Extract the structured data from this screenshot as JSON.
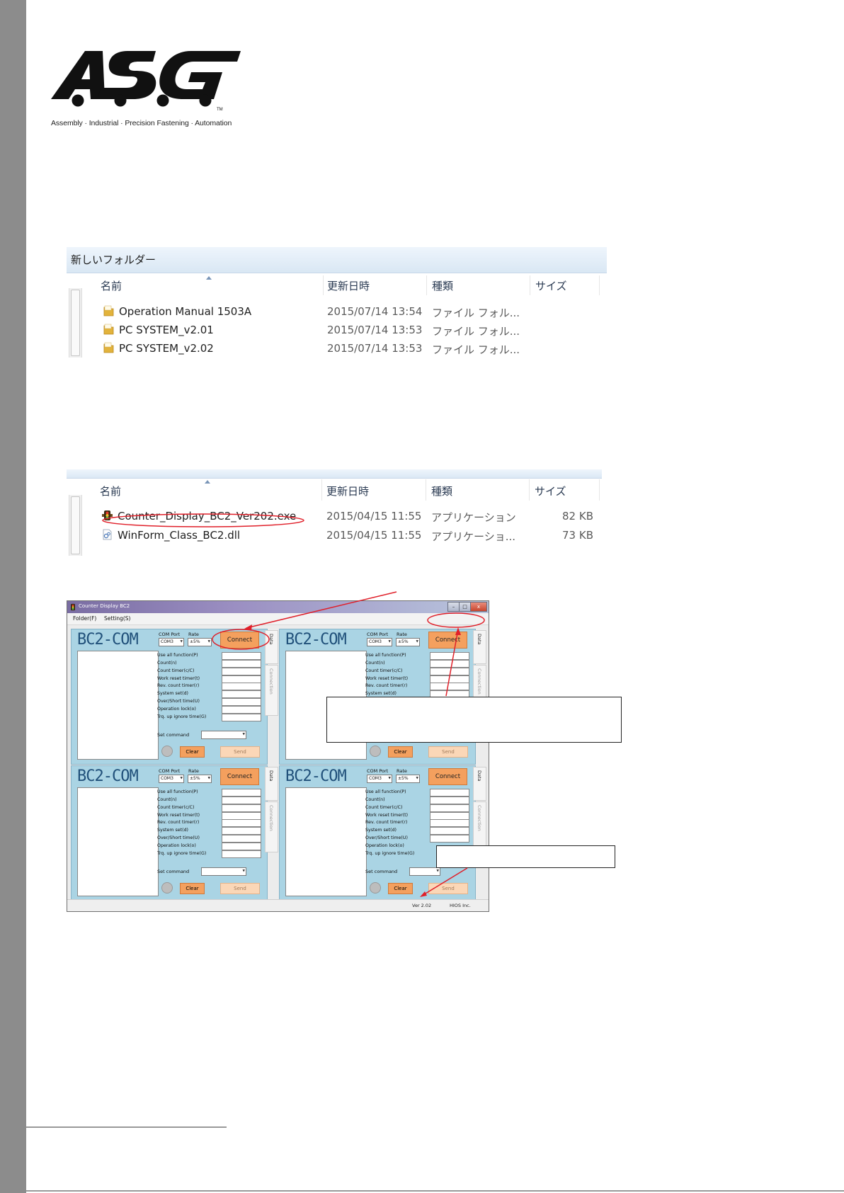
{
  "logo": {
    "text": "ASG",
    "trademark": "TM",
    "tagline": "Assembly · Industrial · Precision Fastening · Automation"
  },
  "explorer1": {
    "folder_title": "新しいフォルダー",
    "columns": [
      "名前",
      "更新日時",
      "種類",
      "サイズ"
    ],
    "rows": [
      {
        "name": "Operation Manual 1503A",
        "date": "2015/07/14 13:54",
        "type": "ファイル フォル...",
        "size": ""
      },
      {
        "name": "PC SYSTEM_v2.01",
        "date": "2015/07/14 13:53",
        "type": "ファイル フォル...",
        "size": ""
      },
      {
        "name": "PC SYSTEM_v2.02",
        "date": "2015/07/14 13:53",
        "type": "ファイル フォル...",
        "size": ""
      }
    ]
  },
  "explorer2": {
    "columns": [
      "名前",
      "更新日時",
      "種類",
      "サイズ"
    ],
    "rows": [
      {
        "name": "Counter_Display_BC2_Ver202.exe",
        "date": "2015/04/15 11:55",
        "type": "アプリケーション",
        "size": "82 KB",
        "icon": "traffic-light-icon"
      },
      {
        "name": "WinForm_Class_BC2.dll",
        "date": "2015/04/15 11:55",
        "type": "アプリケーショ...",
        "size": "73 KB",
        "icon": "dll-file-icon"
      }
    ]
  },
  "app": {
    "window_title": "Counter Display BC2",
    "window_buttons": {
      "minimize": "–",
      "maximize": "□",
      "close": "x"
    },
    "menu": [
      "Folder(F)",
      "Setting(S)"
    ],
    "panel_title": "BC2-COM",
    "com_port_label": "COM Port",
    "rate_label": "Rate",
    "com_port_value": "COM3",
    "rate_value": "±5%",
    "connect_label": "Connect",
    "functions": [
      "Use all function(P)",
      "Count(n)",
      "Count timer(c/C)",
      "Work reset timer(t)",
      "Rev. count timer(r)",
      "System set(d)",
      "Over/Short time(U)",
      "Operation lock(o)",
      "Trq. up ignore time(G)"
    ],
    "set_command_label": "Set command",
    "clear_label": "Clear",
    "send_label": "Send",
    "tab_data": "Data",
    "tab_connection": "Connection",
    "version": "Ver 2.02",
    "company": "HIOS Inc."
  },
  "colors": {
    "panel_bg": "#aad4e4",
    "button_orange": "#f4a05e",
    "annotation_red": "#e0202a",
    "sidebar_gray": "#8c8c8c"
  }
}
